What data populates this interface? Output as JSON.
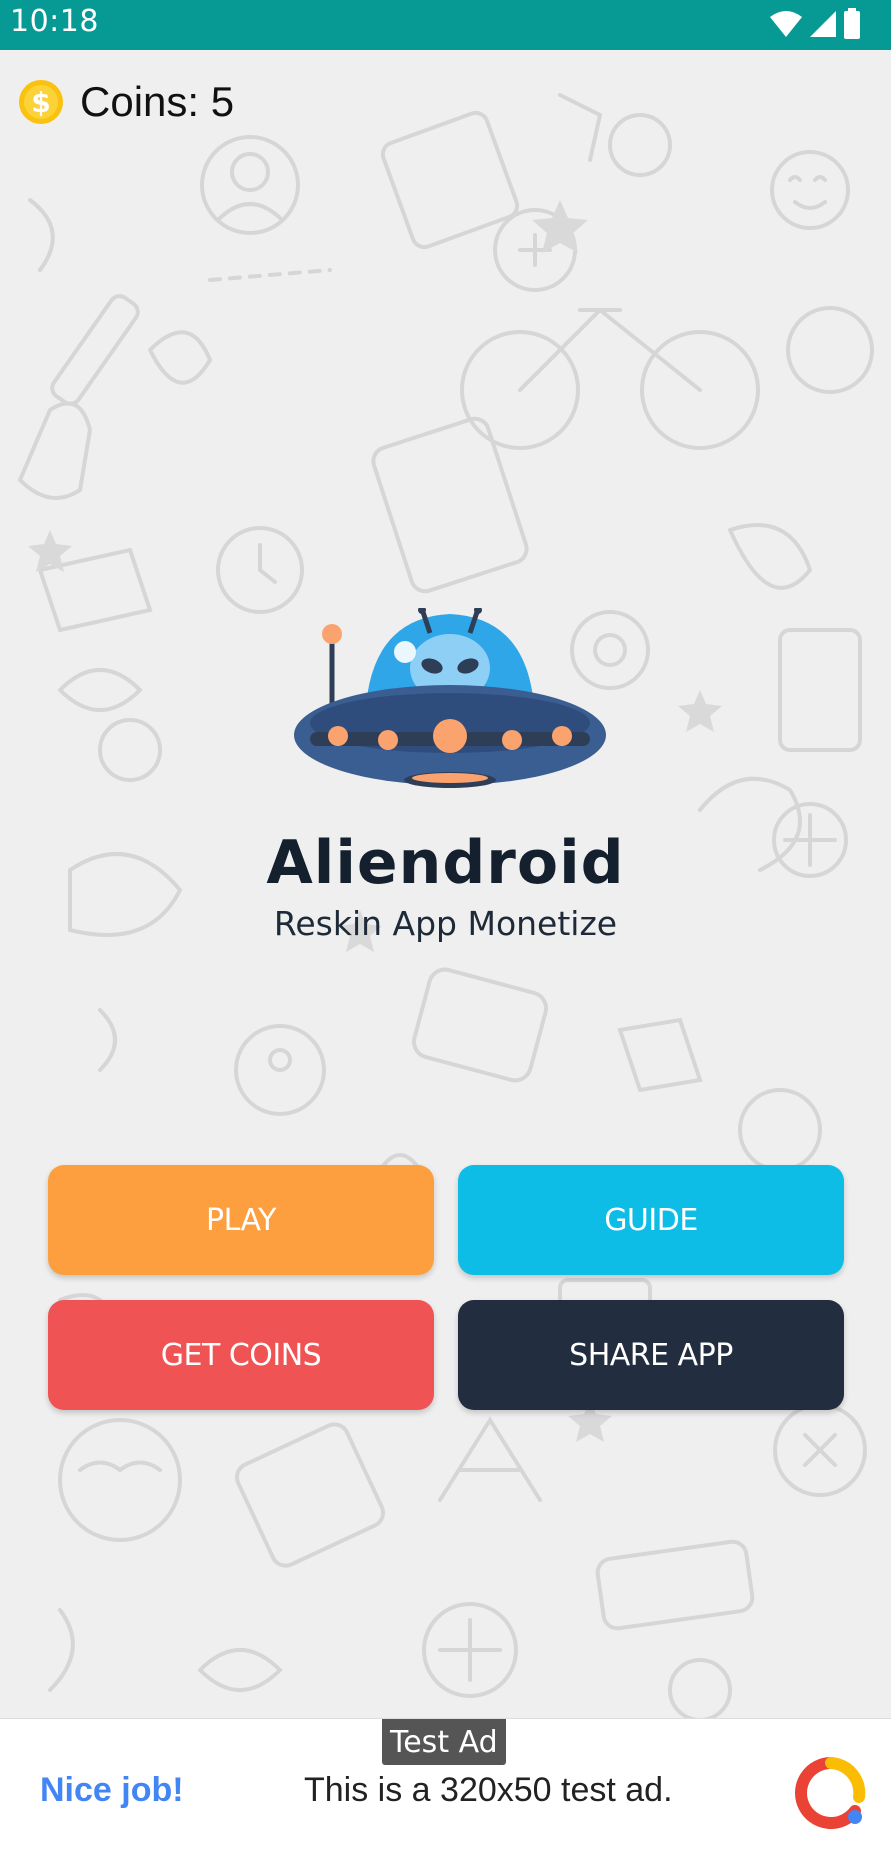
{
  "status_bar": {
    "time": "10:18",
    "icons": [
      "wifi-icon",
      "signal-icon",
      "battery-icon"
    ]
  },
  "coins": {
    "label": "Coins: 5",
    "icon": "dollar-coin-icon"
  },
  "brand": {
    "title": "Aliendroid",
    "subtitle": "Reskin App Monetize"
  },
  "buttons": {
    "play": "PLAY",
    "guide": "GUIDE",
    "get_coins": "GET COINS",
    "share_app": "SHARE APP"
  },
  "colors": {
    "status_bar": "#079a94",
    "play": "#fe9f3f",
    "guide": "#0dbde5",
    "get_coins": "#ef5354",
    "share_app": "#222d3f"
  },
  "ad": {
    "badge": "Test Ad",
    "headline": "Nice job!",
    "text": "This is a 320x50 test ad."
  }
}
